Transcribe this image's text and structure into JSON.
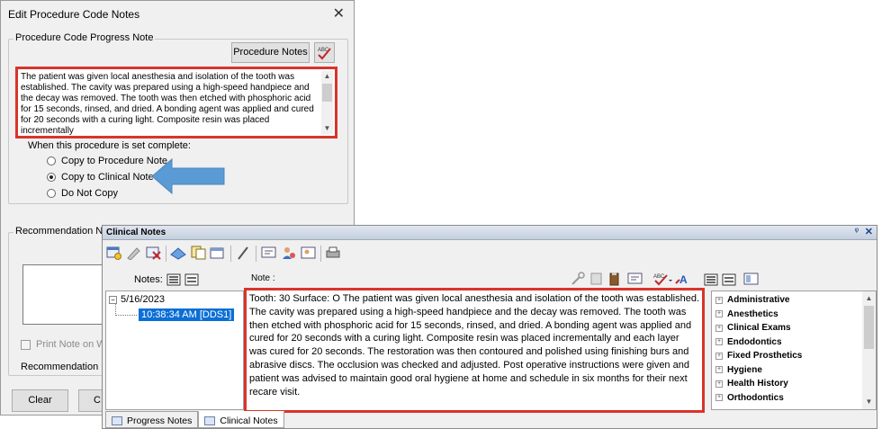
{
  "dialog": {
    "title": "Edit Procedure Code Notes",
    "close_glyph": "✕",
    "group_title": "Procedure Code Progress Note",
    "procedure_notes_button": "Procedure Notes",
    "note_text": "The patient was given local anesthesia and isolation of the tooth was established. The cavity was prepared using a high-speed handpiece and the decay was removed. The tooth was then etched with phosphoric acid for 15 seconds, rinsed, and dried. A bonding agent was applied and cured for 20 seconds with a curing light. Composite resin was placed incrementally",
    "when_label": "When this procedure is set complete:",
    "options": [
      {
        "label": "Copy to Procedure Note",
        "selected": false
      },
      {
        "label": "Copy to Clinical Note",
        "selected": true
      },
      {
        "label": "Do Not Copy",
        "selected": false
      }
    ],
    "recommendation_group": "Recommendation No",
    "print_note_label": "Print Note on W",
    "recommendation_label": "Recommendation D",
    "clear_button": "Clear",
    "second_button": "C",
    "arrow_color": "#5b9bd5",
    "highlight_color": "#d9342b"
  },
  "clinical": {
    "title": "Clinical Notes",
    "pin_glyph": "ᵠ",
    "close_glyph": "✕",
    "notes_label": "Notes:",
    "note_label": "Note :",
    "tree": {
      "date": "5/16/2023",
      "entry": "10:38:34 AM [DDS1]"
    },
    "note_text": "Tooth: 30 Surface: O The patient was given local anesthesia and isolation of the tooth was established. The cavity was prepared using a high-speed handpiece and the decay was removed. The tooth was then etched with phosphoric acid for 15 seconds, rinsed, and dried. A bonding agent was applied and cured for 20 seconds with a curing light. Composite resin was placed incrementally and each layer was cured for 20 seconds. The restoration was then contoured and polished using finishing burs and abrasive discs. The occlusion was checked and adjusted.  Post operative instructions were given and patient was advised to maintain good oral hygiene at home and schedule in six months for their next recare visit.",
    "categories": [
      "Administrative",
      "Anesthetics",
      "Clinical Exams",
      "Endodontics",
      "Fixed Prosthetics",
      "Hygiene",
      "Health History",
      "Orthodontics"
    ],
    "tabs": [
      {
        "label": "Progress Notes",
        "active": false
      },
      {
        "label": "Clinical Notes",
        "active": true
      }
    ]
  }
}
